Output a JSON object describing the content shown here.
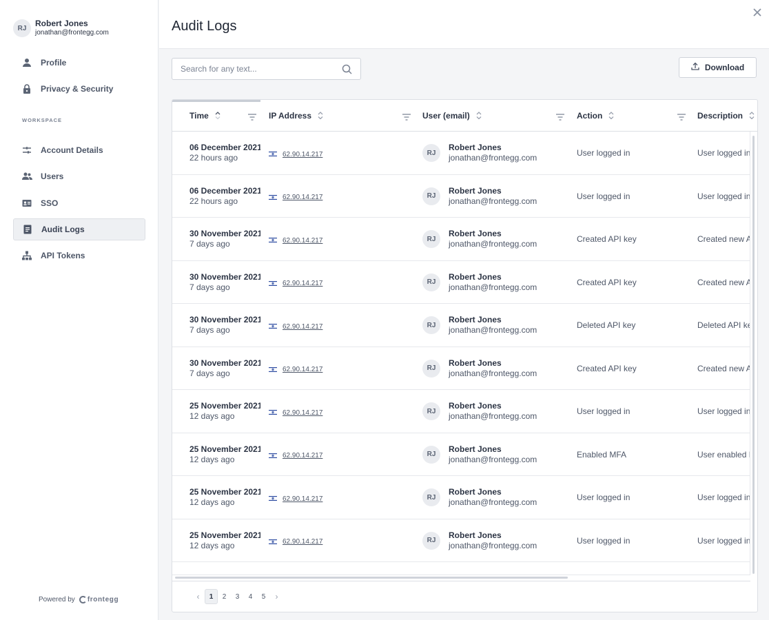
{
  "sidebar": {
    "user": {
      "initials": "RJ",
      "name": "Robert Jones",
      "email": "jonathan@frontegg.com"
    },
    "items_top": [
      {
        "label": "Profile",
        "icon": "person-icon"
      },
      {
        "label": "Privacy & Security",
        "icon": "lock-icon"
      }
    ],
    "section_label": "WORKSPACE",
    "items_workspace": [
      {
        "label": "Account Details",
        "icon": "sliders-icon"
      },
      {
        "label": "Users",
        "icon": "users-icon"
      },
      {
        "label": "SSO",
        "icon": "id-card-icon"
      },
      {
        "label": "Audit Logs",
        "icon": "document-icon",
        "active": true
      },
      {
        "label": "API Tokens",
        "icon": "network-icon"
      }
    ],
    "footer": {
      "powered_by": "Powered by",
      "brand": "frontegg"
    }
  },
  "main": {
    "title": "Audit Logs",
    "search": {
      "placeholder": "Search for any text..."
    },
    "download_label": "Download",
    "table": {
      "columns": [
        "Time",
        "IP Address",
        "User (email)",
        "Action",
        "Description"
      ],
      "rows": [
        {
          "date": "06 December 2021",
          "ago": "22 hours ago",
          "ip": "62.90.14.217",
          "user_initials": "RJ",
          "user_name": "Robert Jones",
          "user_email": "jonathan@frontegg.com",
          "action": "User logged in",
          "description": "User logged in"
        },
        {
          "date": "06 December 2021",
          "ago": "22 hours ago",
          "ip": "62.90.14.217",
          "user_initials": "RJ",
          "user_name": "Robert Jones",
          "user_email": "jonathan@frontegg.com",
          "action": "User logged in",
          "description": "User logged in"
        },
        {
          "date": "30 November 2021",
          "ago": "7 days ago",
          "ip": "62.90.14.217",
          "user_initials": "RJ",
          "user_name": "Robert Jones",
          "user_email": "jonathan@frontegg.com",
          "action": "Created API key",
          "description": "Created new A"
        },
        {
          "date": "30 November 2021",
          "ago": "7 days ago",
          "ip": "62.90.14.217",
          "user_initials": "RJ",
          "user_name": "Robert Jones",
          "user_email": "jonathan@frontegg.com",
          "action": "Created API key",
          "description": "Created new A"
        },
        {
          "date": "30 November 2021",
          "ago": "7 days ago",
          "ip": "62.90.14.217",
          "user_initials": "RJ",
          "user_name": "Robert Jones",
          "user_email": "jonathan@frontegg.com",
          "action": "Deleted API key",
          "description": "Deleted API ke"
        },
        {
          "date": "30 November 2021",
          "ago": "7 days ago",
          "ip": "62.90.14.217",
          "user_initials": "RJ",
          "user_name": "Robert Jones",
          "user_email": "jonathan@frontegg.com",
          "action": "Created API key",
          "description": "Created new A"
        },
        {
          "date": "25 November 2021",
          "ago": "12 days ago",
          "ip": "62.90.14.217",
          "user_initials": "RJ",
          "user_name": "Robert Jones",
          "user_email": "jonathan@frontegg.com",
          "action": "User logged in",
          "description": "User logged in"
        },
        {
          "date": "25 November 2021",
          "ago": "12 days ago",
          "ip": "62.90.14.217",
          "user_initials": "RJ",
          "user_name": "Robert Jones",
          "user_email": "jonathan@frontegg.com",
          "action": "Enabled MFA",
          "description": "User enabled M"
        },
        {
          "date": "25 November 2021",
          "ago": "12 days ago",
          "ip": "62.90.14.217",
          "user_initials": "RJ",
          "user_name": "Robert Jones",
          "user_email": "jonathan@frontegg.com",
          "action": "User logged in",
          "description": "User logged in"
        },
        {
          "date": "25 November 2021",
          "ago": "12 days ago",
          "ip": "62.90.14.217",
          "user_initials": "RJ",
          "user_name": "Robert Jones",
          "user_email": "jonathan@frontegg.com",
          "action": "User logged in",
          "description": "User logged in"
        }
      ]
    },
    "pagination": {
      "pages": [
        "1",
        "2",
        "3",
        "4",
        "5"
      ],
      "current": "1",
      "prev": "‹",
      "next": "›"
    }
  }
}
